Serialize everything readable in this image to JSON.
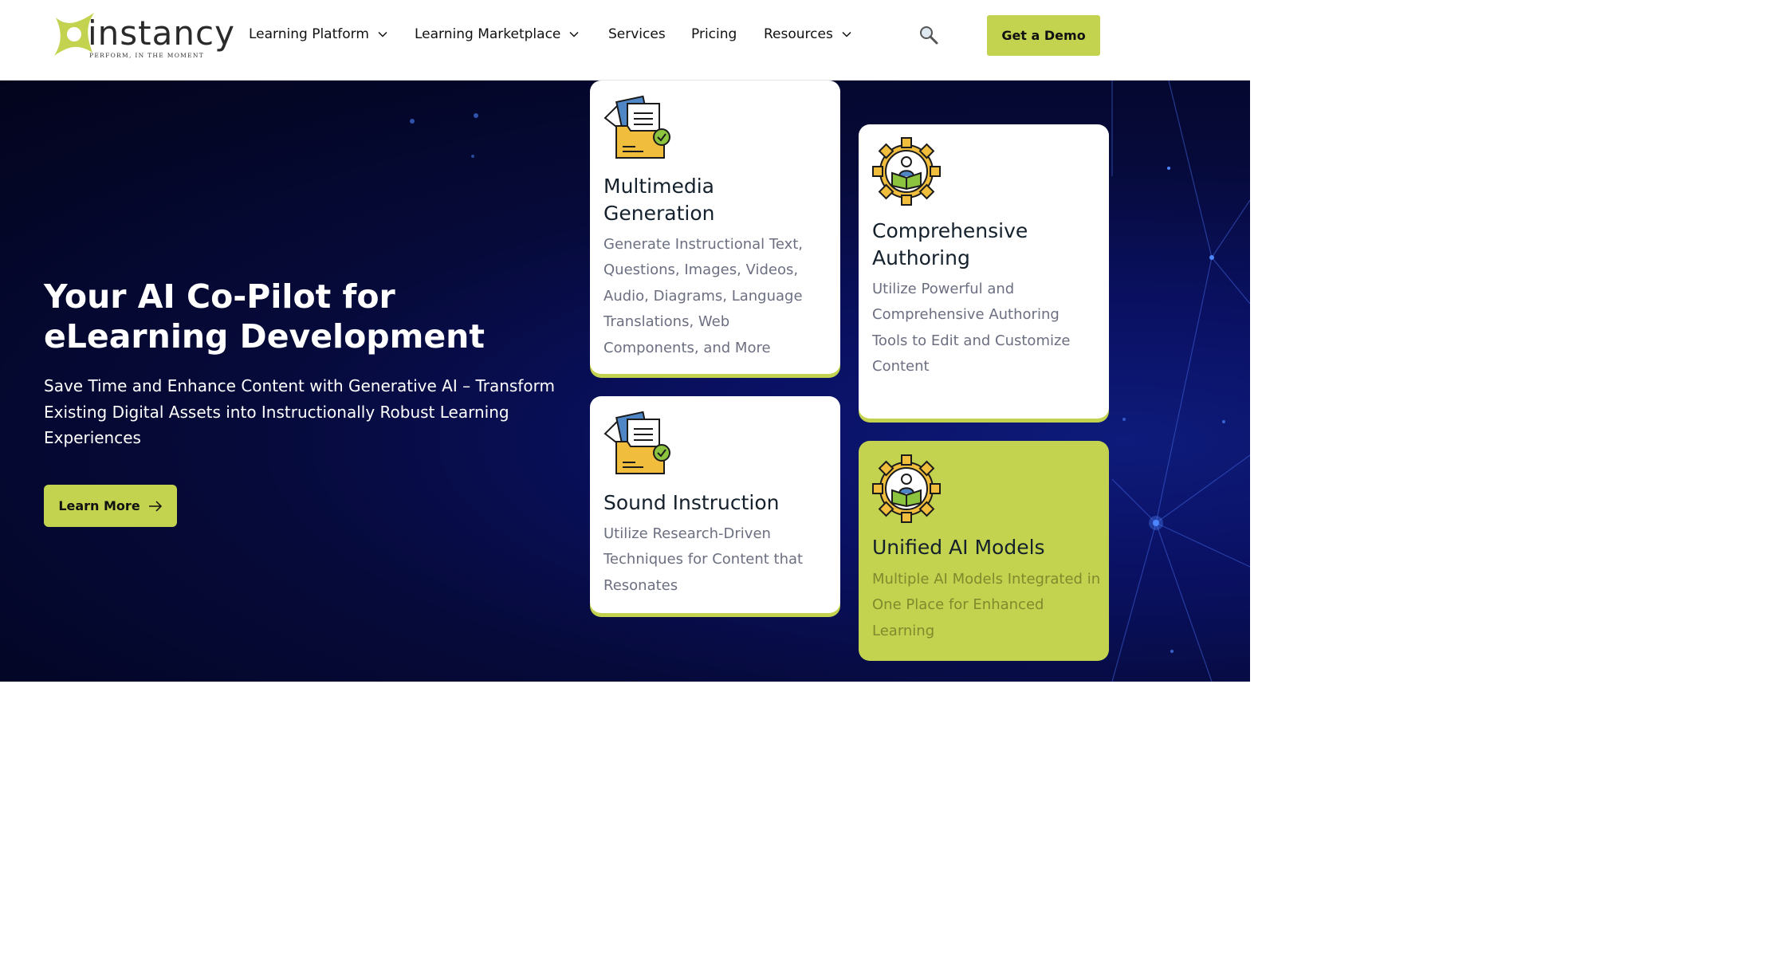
{
  "brand": {
    "name": "instancy",
    "tagline": "PERFORM, IN THE MOMENT",
    "accent": "#c3d350"
  },
  "nav": {
    "items": [
      {
        "label": "Learning Platform",
        "dropdown": true
      },
      {
        "label": "Learning Marketplace",
        "dropdown": true
      },
      {
        "label": "Services",
        "dropdown": false
      },
      {
        "label": "Pricing",
        "dropdown": false
      },
      {
        "label": "Resources",
        "dropdown": true
      }
    ],
    "search_icon": "search-icon",
    "cta_label": "Get a Demo"
  },
  "hero": {
    "title": "Your AI Co-Pilot for eLearning Development",
    "subtitle": "Save Time and Enhance Content with Generative AI – Transform Existing Digital Assets into Instructionally Robust Learning Experiences",
    "button_label": "Learn More",
    "background": "#050a3c"
  },
  "cards": [
    {
      "icon": "folder-document-icon",
      "title": "Multimedia Generation",
      "description": "Generate Instructional Text, Questions, Images, Videos, Audio, Diagrams, Language Translations, Web Components, and More"
    },
    {
      "icon": "gear-reader-icon",
      "title": "Comprehensive Authoring",
      "description": "Utilize Powerful and Comprehensive Authoring Tools to Edit and Customize Content"
    },
    {
      "icon": "folder-document-icon",
      "title": "Sound Instruction",
      "description": "Utilize Research-Driven Techniques for Content that Resonates"
    },
    {
      "icon": "gear-reader-icon",
      "title": "Unified AI Models",
      "description": "Multiple AI Models Integrated in One Place for Enhanced Learning"
    }
  ]
}
